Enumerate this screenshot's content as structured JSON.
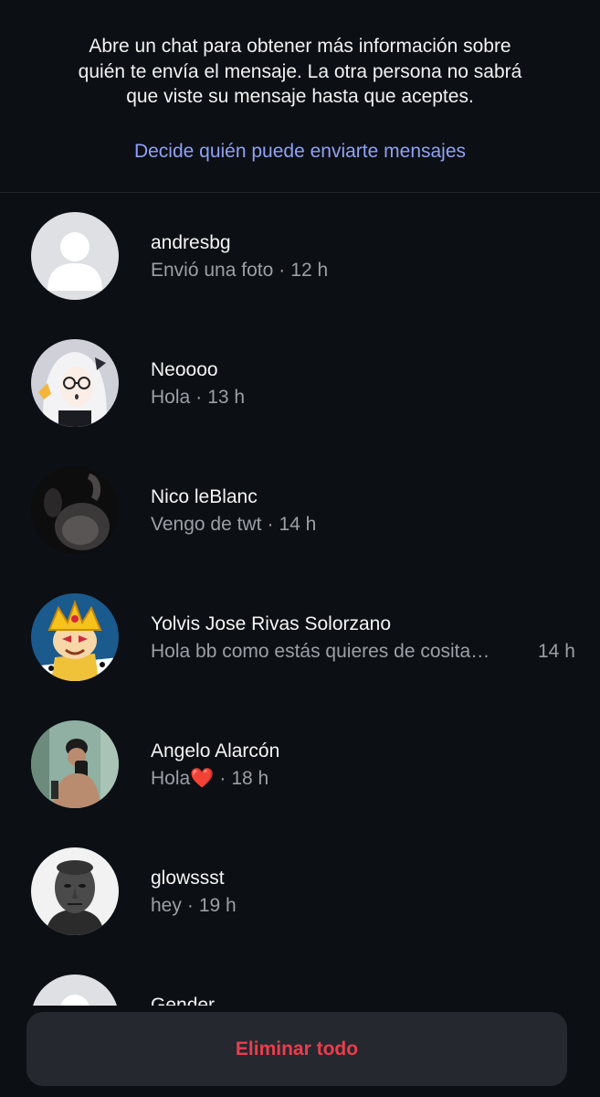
{
  "header": {
    "info_text": "Abre un chat para obtener más información sobre quién te envía el mensaje. La otra persona no sabrá que viste su mensaje hasta que aceptes.",
    "settings_link": "Decide quién puede enviarte mensajes"
  },
  "requests": [
    {
      "name": "andresbg",
      "preview": "Envió una foto",
      "time": "12 h",
      "avatar": "default-avatar-icon"
    },
    {
      "name": "Neoooo",
      "preview": "Hola",
      "time": "13 h",
      "avatar": "anime-avatar"
    },
    {
      "name": "Nico leBlanc",
      "preview": "Vengo de twt",
      "time": "14 h",
      "avatar": "dark-photo-avatar"
    },
    {
      "name": "Yolvis Jose Rivas Solorzano",
      "preview": "Hola bb como estás quieres de cosita…",
      "time": "14 h",
      "avatar": "cartoon-king-avatar"
    },
    {
      "name": "Angelo Alarcón",
      "preview": "Hola",
      "preview_emoji": "❤️",
      "time": "18 h",
      "avatar": "mirror-selfie-avatar"
    },
    {
      "name": "glowssst",
      "preview": "hey",
      "time": "19 h",
      "avatar": "statue-avatar"
    },
    {
      "name": "Gender",
      "avatar": "default-avatar-icon"
    }
  ],
  "footer": {
    "delete_all": "Eliminar todo"
  },
  "colors": {
    "background": "#0c0f14",
    "link": "#8fa2f4",
    "secondary_text": "#9aa0a6",
    "danger": "#ec3d4c",
    "button_bg": "#25282f"
  }
}
